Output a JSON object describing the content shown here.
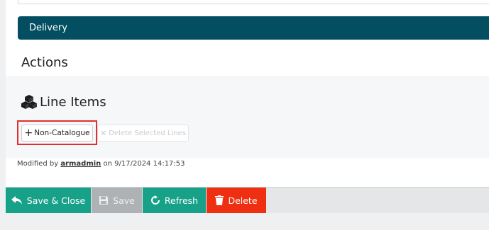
{
  "delivery": {
    "label": "Delivery"
  },
  "actions": {
    "heading": "Actions"
  },
  "line_items": {
    "title": "Line Items",
    "non_catalogue_label": "Non-Catalogue",
    "delete_selected_label": "Delete Selected Lines"
  },
  "modified": {
    "prefix": "Modified by",
    "user": "armadmin",
    "on": "on",
    "timestamp": "9/17/2024 14:17:53"
  },
  "footer": {
    "save_close_label": "Save & Close",
    "save_label": "Save",
    "refresh_label": "Refresh",
    "delete_label": "Delete"
  },
  "colors": {
    "header_teal": "#034f61",
    "action_teal": "#18a189",
    "delete_red": "#ee2f12",
    "highlight": "#e0302e"
  }
}
